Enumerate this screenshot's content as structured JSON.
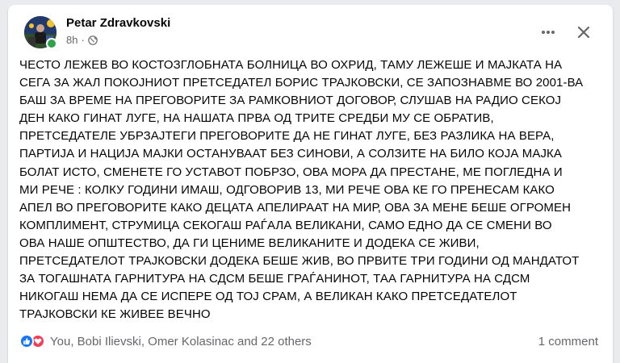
{
  "post": {
    "author": "Petar Zdravkovski",
    "time": "8h",
    "separator": "·",
    "privacy_icon": "globe-icon",
    "more_icon": "more-horizontal-icon",
    "close_icon": "close-icon",
    "text": "ЧЕСТО ЛЕЖЕВ ВО КОСТОЗГЛОБНАТА БОЛНИЦА ВО ОХРИД, ТАМУ ЛЕЖЕШЕ И МАЈКАТА НА\nСЕГА ЗА ЖАЛ ПОКОЈНИОТ ПРЕТСЕДАТЕЛ БОРИС ТРАЈКОВСКИ, СЕ ЗАПОЗНАВМЕ ВО 2001-ВА\nБАШ ЗА ВРЕМЕ НА ПРЕГОВОРИТЕ ЗА РАМКОВНИОТ ДОГОВОР, СЛУШАВ НА РАДИО СЕКОЈ\nДЕН КАКО ГИНАТ ЛУГЕ, НА НАШАТА ПРВА ОД ТРИТЕ СРЕДБИ МУ СЕ ОБРАТИВ,\nПРЕТСЕДАТЕЛЕ УБРЗАЈТЕГИ ПРЕГОВОРИТЕ ДА НЕ ГИНАТ ЛУГЕ, БЕЗ РАЗЛИКА НА ВЕРА,\nПАРТИЈА И НАЦИЈА МАЈКИ ОСТАНУВААТ БЕЗ СИНОВИ, А СОЛЗИТЕ НА БИЛО КОЈА МАЈКА\nБОЛАТ ИСТО, СМЕНЕТЕ ГО УСТАВОТ ПОБРЗО, ОВА МОРА ДА ПРЕСТАНЕ, МЕ ПОГЛЕДНА И\nМИ РЕЧЕ : КОЛКУ ГОДИНИ ИМАШ, ОДГОВОРИВ 13, МИ РЕЧЕ ОВА КЕ ГО ПРЕНЕСАМ КАКО\nАПЕЛ ВО ПРЕГОВОРИТЕ КАКО ДЕЦАТА АПЕЛИРААТ НА МИР, ОВА ЗА МЕНЕ БЕШЕ ОГРОМЕН\nКОМПЛИМЕНТ, СТРУМИЦА СЕКОГАШ РАЃАЛА ВЕЛИКАНИ, САМО ЕДНО ДА СЕ СМЕНИ ВО\nОВА НАШЕ ОПШТЕСТВО, ДА ГИ ЦЕНИМЕ ВЕЛИКАНИТЕ И ДОДЕКА СЕ ЖИВИ,\nПРЕТСЕДАТЕЛОТ ТРАЈКОВСКИ ДОДЕКА БЕШЕ ЖИВ, ВО ПРВИТЕ ТРИ ГОДИНИ ОД МАНДАТОТ\nЗА ТОГАШНАТА ГАРНИТУРА НА СДСМ БЕШЕ ГРАЃАНИНОТ, ТАА ГАРНИТУРА НА СДСМ\nНИКОГАШ НЕМА ДА СЕ ИСПЕРЕ ОД ТОЈ СРАМ, А ВЕЛИКАН КАКО ПРЕТСЕДАТЕЛОТ\nТРАЈКОВСКИ КЕ ЖИВЕЕ ВЕЧНО"
  },
  "footer": {
    "reaction_icons": [
      "like-icon",
      "love-icon"
    ],
    "reactors": "You, Bobi Ilievski, Omer Kolasinac and 22 others",
    "comments": "1 comment"
  },
  "colors": {
    "like": "#1877f2",
    "love": "#f33e58",
    "online": "#31a24c",
    "secondary_text": "#65676b"
  }
}
